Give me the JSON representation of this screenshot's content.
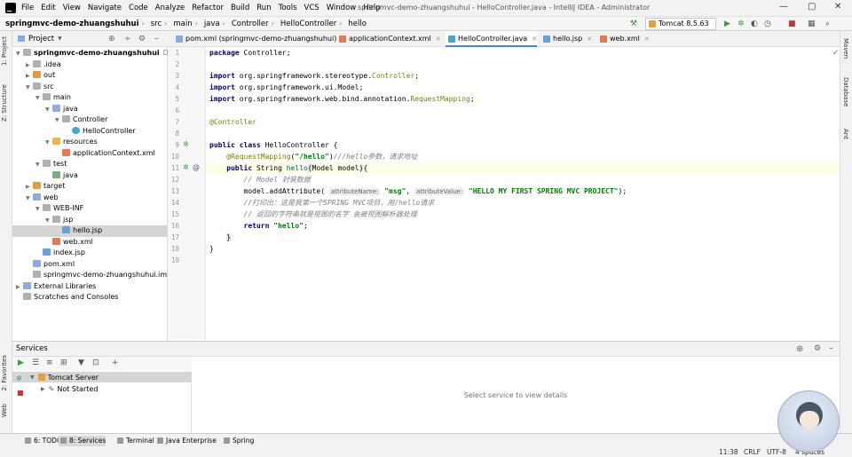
{
  "window": {
    "title": "springmvc-demo-zhuangshuhui - HelloController.java - IntelliJ IDEA - Administrator"
  },
  "menu": [
    "File",
    "Edit",
    "View",
    "Navigate",
    "Code",
    "Analyze",
    "Refactor",
    "Build",
    "Run",
    "Tools",
    "VCS",
    "Window",
    "Help"
  ],
  "breadcrumbs": [
    "springmvc-demo-zhuangshuhui",
    "src",
    "main",
    "java",
    "Controller",
    "HelloController",
    "hello"
  ],
  "run_config": "Tomcat 8.5.63",
  "project_panel": {
    "title": "Project"
  },
  "tree": [
    {
      "label": "springmvc-demo-zhuangshuhui",
      "suffix": "D:\\Pro",
      "depth": 0,
      "arrow": "▼",
      "icon": "f-gray",
      "bold": true
    },
    {
      "label": ".idea",
      "depth": 1,
      "arrow": "▶",
      "icon": "f-gray"
    },
    {
      "label": "out",
      "depth": 1,
      "arrow": "▶",
      "icon": "f-o"
    },
    {
      "label": "src",
      "depth": 1,
      "arrow": "▼",
      "icon": "f-gray"
    },
    {
      "label": "main",
      "depth": 2,
      "arrow": "▼",
      "icon": "f-gray"
    },
    {
      "label": "java",
      "depth": 3,
      "arrow": "▼",
      "icon": "f-b"
    },
    {
      "label": "Controller",
      "depth": 4,
      "arrow": "▼",
      "icon": "f-gray"
    },
    {
      "label": "HelloController",
      "depth": 5,
      "arrow": "",
      "icon": "f-c"
    },
    {
      "label": "resources",
      "depth": 3,
      "arrow": "▼",
      "icon": "f-y"
    },
    {
      "label": "applicationContext.xml",
      "depth": 4,
      "arrow": "",
      "icon": "f-x"
    },
    {
      "label": "test",
      "depth": 2,
      "arrow": "▼",
      "icon": "f-gray"
    },
    {
      "label": "java",
      "depth": 3,
      "arrow": "",
      "icon": "f-g"
    },
    {
      "label": "target",
      "depth": 1,
      "arrow": "▶",
      "icon": "f-o"
    },
    {
      "label": "web",
      "depth": 1,
      "arrow": "▼",
      "icon": "f-b"
    },
    {
      "label": "WEB-INF",
      "depth": 2,
      "arrow": "▼",
      "icon": "f-gray"
    },
    {
      "label": "jsp",
      "depth": 3,
      "arrow": "▼",
      "icon": "f-gray"
    },
    {
      "label": "hello.jsp",
      "depth": 4,
      "arrow": "",
      "icon": "f-j",
      "selected": true
    },
    {
      "label": "web.xml",
      "depth": 3,
      "arrow": "",
      "icon": "f-x"
    },
    {
      "label": "index.jsp",
      "depth": 2,
      "arrow": "",
      "icon": "f-j"
    },
    {
      "label": "pom.xml",
      "depth": 1,
      "arrow": "",
      "icon": "f-b"
    },
    {
      "label": "springmvc-demo-zhuangshuhui.iml",
      "depth": 1,
      "arrow": "",
      "icon": "f-gray"
    },
    {
      "label": "External Libraries",
      "depth": 0,
      "arrow": "▶",
      "icon": "f-b"
    },
    {
      "label": "Scratches and Consoles",
      "depth": 0,
      "arrow": "",
      "icon": "f-gray"
    }
  ],
  "tabs": [
    {
      "label": "pom.xml (springmvc-demo-zhuangshuhui)",
      "icon": "#8faadc"
    },
    {
      "label": "applicationContext.xml",
      "icon": "#e07b56"
    },
    {
      "label": "HelloController.java",
      "icon": "#4aa6c9",
      "active": true
    },
    {
      "label": "hello.jsp",
      "icon": "#6ba0d8"
    },
    {
      "label": "web.xml",
      "icon": "#e07b56"
    }
  ],
  "code": {
    "line_numbers": [
      "1",
      "2",
      "3",
      "4",
      "5",
      "6",
      "7",
      "8",
      "9",
      "10",
      "11",
      "12",
      "13",
      "14",
      "15",
      "16",
      "17",
      "18",
      "19"
    ],
    "current_line": 11
  },
  "services": {
    "title": "Services",
    "server": "Tomcat Server",
    "status": "Not Started",
    "empty_text": "Select service to view details"
  },
  "bottom_tabs": [
    "6: TODO",
    "8: Services",
    "Terminal",
    "Java Enterprise",
    "Spring"
  ],
  "left_strip": [
    "1: Project",
    "Z: Structure",
    "2: Favorites",
    "Web"
  ],
  "right_strip": [
    "Maven",
    "Database",
    "Ant"
  ],
  "status": {
    "pos": "11:38",
    "line_sep": "CRLF",
    "encoding": "UTF-8",
    "indent": "4 spaces"
  },
  "colors": {
    "accent": "#4a88c7",
    "keyword": "#000080",
    "string": "#008000",
    "annotation": "#808000",
    "comment": "#808080"
  }
}
